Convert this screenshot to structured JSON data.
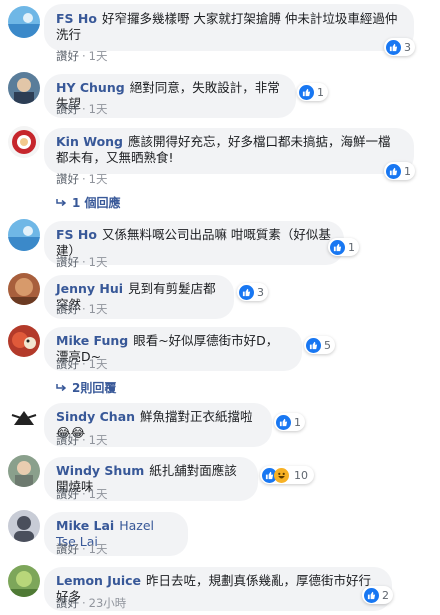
{
  "like_label": "讚好",
  "comments": [
    {
      "author": "FS Ho",
      "text": "好窄攞多幾樣嘢 大家就打架搶膊 仲未計垃圾車經過仲洗行",
      "time": "1天",
      "reactions": "3"
    },
    {
      "author": "HY Chung",
      "text": "絕對同意，失敗設計，非常失望",
      "time": "1天",
      "reactions": "1"
    },
    {
      "author": "Kin Wong",
      "text": "應該開得好充忘，好多檔口都未搞掂，海鮮一檔都未有，又無晒熟食!",
      "time": "1天",
      "reactions": "1",
      "replies": "1 個回應"
    },
    {
      "author": "FS Ho",
      "text": "又係無料嘅公司出品嘛 咁嘅質素（好似基建）",
      "time": "1天",
      "reactions": "1"
    },
    {
      "author": "Jenny Hui",
      "text": "見到有剪髮店都突然",
      "time": "1天",
      "reactions": "3"
    },
    {
      "author": "Mike Fung",
      "text": "眼看~好似厚德街市好D，漂亮D~",
      "time": "1天",
      "reactions": "5",
      "replies": "2則回覆"
    },
    {
      "author": "Sindy Chan",
      "text": "鮮魚擋對正衣紙擋啦😂😂",
      "time": "1天",
      "reactions": "1"
    },
    {
      "author": "Windy Shum",
      "text": "紙扎舖對面應該開燒味",
      "time": "1天",
      "reactions": "10"
    },
    {
      "author": "Mike Lai",
      "text": "Hazel Tse Lai",
      "time": "1天",
      "reactions": ""
    },
    {
      "author": "Lemon Juice",
      "text": "昨日去咗，規劃真係幾亂，厚德街市好行好多",
      "time": "23小時",
      "reactions": "2"
    }
  ],
  "colors": {
    "link": "#385898",
    "bubble": "#f2f3f5",
    "like": "#1877f2"
  }
}
